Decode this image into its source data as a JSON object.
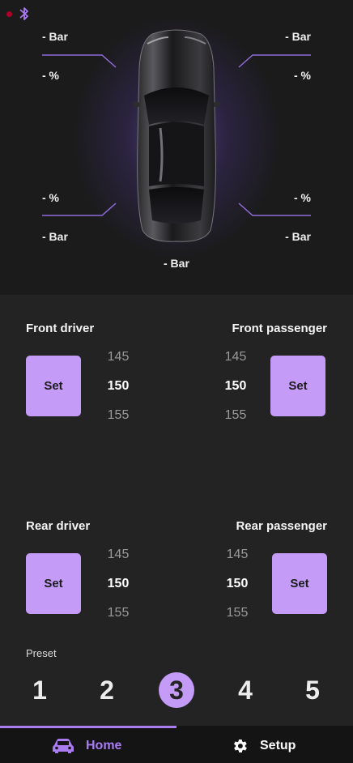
{
  "colors": {
    "accent": "#c49cf7",
    "accent_strong": "#a97cf0",
    "status_dot": "#b0002a"
  },
  "status": {
    "connection_icon": "bluetooth-icon"
  },
  "tires": {
    "front_left": {
      "pressure": "- Bar",
      "percent": "- %"
    },
    "front_right": {
      "pressure": "- Bar",
      "percent": "- %"
    },
    "rear_left": {
      "percent": "- %",
      "pressure": "- Bar"
    },
    "rear_right": {
      "percent": "- %",
      "pressure": "- Bar"
    },
    "spare": {
      "pressure": "- Bar"
    }
  },
  "seats": {
    "front_driver": {
      "label": "Front driver",
      "set_label": "Set",
      "values": [
        "145",
        "150",
        "155"
      ]
    },
    "front_passenger": {
      "label": "Front passenger",
      "set_label": "Set",
      "values": [
        "145",
        "150",
        "155"
      ]
    },
    "rear_driver": {
      "label": "Rear driver",
      "set_label": "Set",
      "values": [
        "145",
        "150",
        "155"
      ]
    },
    "rear_passenger": {
      "label": "Rear passenger",
      "set_label": "Set",
      "values": [
        "145",
        "150",
        "155"
      ]
    }
  },
  "preset": {
    "label": "Preset",
    "items": [
      "1",
      "2",
      "3",
      "4",
      "5"
    ],
    "active": "3"
  },
  "nav": {
    "home": {
      "label": "Home",
      "icon": "car-icon"
    },
    "setup": {
      "label": "Setup",
      "icon": "gear-icon"
    }
  }
}
